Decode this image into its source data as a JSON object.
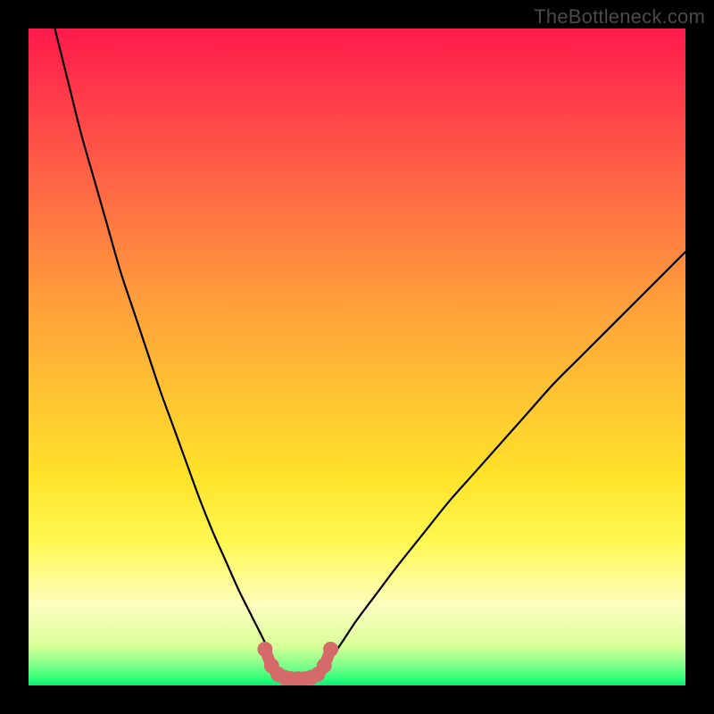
{
  "watermark": {
    "text": "TheBottleneck.com"
  },
  "colors": {
    "frame": "#000000",
    "curve": "#000000",
    "marker": "#d46a6a",
    "gradient_stops": [
      "#ff1a4b",
      "#ff3a4a",
      "#ff6a45",
      "#ff9a3c",
      "#ffc233",
      "#ffe22a",
      "#fff850",
      "#fdfec0",
      "#d8ff97",
      "#7dff8a",
      "#2eff78",
      "#12e879"
    ]
  },
  "chart_data": {
    "type": "line",
    "title": "",
    "xlabel": "",
    "ylabel": "",
    "xlim": [
      0,
      100
    ],
    "ylim": [
      0,
      100
    ],
    "series": [
      {
        "name": "left-curve",
        "x": [
          4,
          6,
          8,
          10,
          12,
          14,
          16,
          18,
          20,
          22,
          24,
          26,
          28,
          30,
          32,
          34,
          36,
          37
        ],
        "values": [
          100,
          92,
          84,
          77,
          70,
          63,
          57,
          51,
          45,
          39.5,
          34,
          28.5,
          23.5,
          19,
          14.5,
          10.5,
          6.5,
          4
        ]
      },
      {
        "name": "right-curve",
        "x": [
          46,
          48,
          50,
          53,
          56,
          60,
          64,
          68,
          72,
          76,
          80,
          84,
          88,
          92,
          96,
          100
        ],
        "values": [
          4,
          7,
          10,
          14,
          18,
          23,
          28,
          32.5,
          37,
          41.5,
          46,
          50,
          54,
          58,
          62,
          66
        ]
      },
      {
        "name": "trough-markers",
        "x": [
          36,
          37,
          38,
          39,
          40,
          41,
          42,
          43,
          44,
          45,
          46
        ],
        "values": [
          5.5,
          3.0,
          1.7,
          1.2,
          1.0,
          1.0,
          1.0,
          1.2,
          1.7,
          3.0,
          5.5
        ]
      }
    ]
  }
}
